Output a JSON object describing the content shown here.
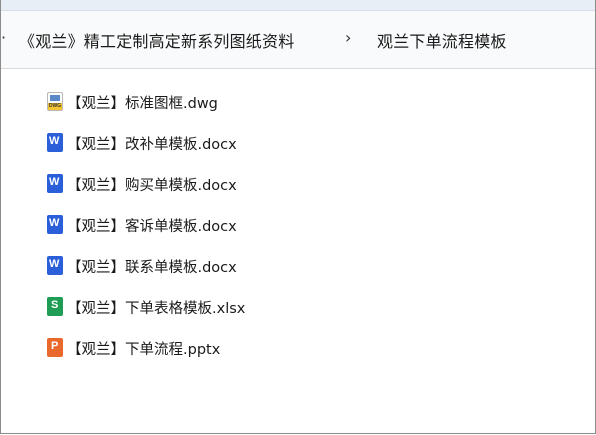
{
  "breadcrumb": {
    "prefix": "·",
    "parent": "《观兰》精工定制高定新系列图纸资料",
    "separator": "›",
    "current": "观兰下单流程模板"
  },
  "files": [
    {
      "name": "【观兰】标准图框.dwg",
      "type": "dwg",
      "icon": "dwg-file-icon",
      "icon_text": "DWG"
    },
    {
      "name": "【观兰】改补单模板.docx",
      "type": "docx",
      "icon": "word-file-icon"
    },
    {
      "name": "【观兰】购买单模板.docx",
      "type": "docx",
      "icon": "word-file-icon"
    },
    {
      "name": "【观兰】客诉单模板.docx",
      "type": "docx",
      "icon": "word-file-icon"
    },
    {
      "name": "【观兰】联系单模板.docx",
      "type": "docx",
      "icon": "word-file-icon"
    },
    {
      "name": "【观兰】下单表格模板.xlsx",
      "type": "xlsx",
      "icon": "sheet-file-icon"
    },
    {
      "name": "【观兰】下单流程.pptx",
      "type": "pptx",
      "icon": "ppt-file-icon"
    }
  ],
  "colors": {
    "word": "#2b5fd9",
    "sheet": "#1f9d55",
    "ppt": "#e8692b",
    "dwg_accent": "#f4c430"
  }
}
